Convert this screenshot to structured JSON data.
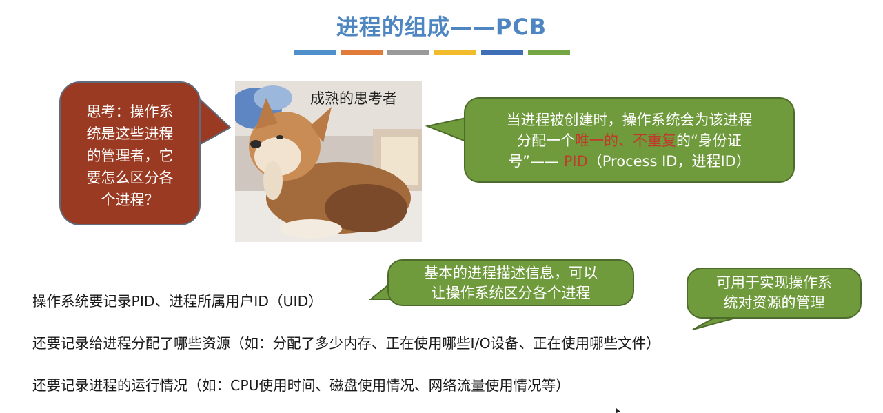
{
  "title": "进程的组成——PCB",
  "title_bars": [
    "#4f8fcc",
    "#e07b39",
    "#9a9a9a",
    "#f2bb2b",
    "#3f6fb6",
    "#74a743"
  ],
  "think_bubble": {
    "line1": "思考：操作系",
    "line2": "统是这些进程",
    "line3": "的管理者，它",
    "line4": "要怎么区分各",
    "line5": "个进程？"
  },
  "photo": {
    "caption": "成熟的思考者"
  },
  "pid_bubble": {
    "p1": "当进程被创建时，操作系统会为该进程",
    "p2": "分配一个",
    "p3": "唯一的、不重复",
    "p4": "的“身份证",
    "p5": "号”—— ",
    "p6": "PID",
    "p7": "（Process ID，进程ID）"
  },
  "desc_bubble": {
    "line1": "基本的进程描述信息，可以",
    "line2": "让操作系统区分各个进程"
  },
  "res_bubble": {
    "line1": "可用于实现操作系",
    "line2": "统对资源的管理"
  },
  "lines": {
    "l1": "操作系统要记录PID、进程所属用户ID（UID）",
    "l2": "还要记录给进程分配了哪些资源（如：分配了多少内存、正在使用哪些I/O设备、正在使用哪些文件）",
    "l3": "还要记录进程的运行情况（如：CPU使用时间、磁盘使用情况、网络流量使用情况等）"
  }
}
